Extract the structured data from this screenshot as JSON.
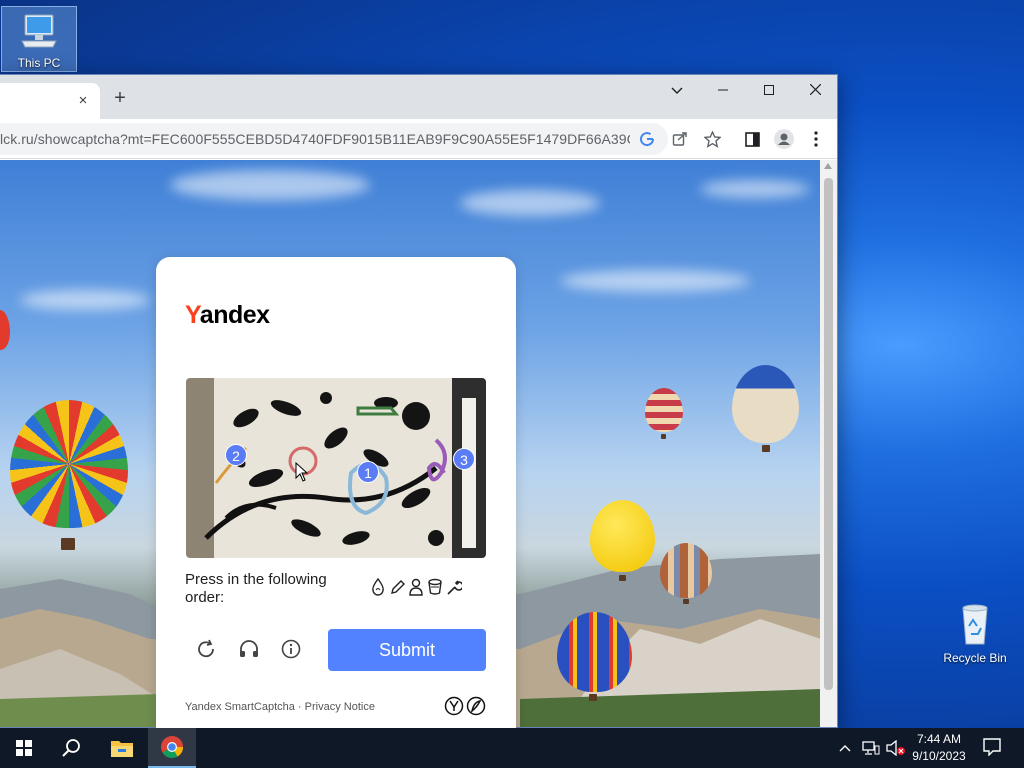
{
  "desktop": {
    "icons": [
      {
        "label": "This PC"
      },
      {
        "label": "Recycle Bin"
      }
    ]
  },
  "browser": {
    "tab": {
      "close_glyph": "×"
    },
    "new_tab_glyph": "+",
    "window_controls": {
      "tab_search": "⌄",
      "minimize": "—",
      "maximize": "☐",
      "close": "✕"
    },
    "address_bar": {
      "url": "lck.ru/showcaptcha?mt=FEC600F555CEBD5D4740FDF9015B11EAB9F9C90A55E5F1479DF66A39C93D..."
    },
    "toolbar_icons": [
      "google-lens-icon",
      "share-icon",
      "bookmark-star-icon",
      "side-panel-icon",
      "profile-icon",
      "menu-icon"
    ]
  },
  "captcha": {
    "brand_first_letter": "Y",
    "brand_rest": "andex",
    "markers": [
      "1",
      "2",
      "3"
    ],
    "instruction": "Press in the following order:",
    "order_icons": [
      "drop-icon",
      "pencil-icon",
      "person-icon",
      "bucket-icon",
      "wrench-icon"
    ],
    "controls": [
      "refresh-icon",
      "headphones-icon",
      "info-icon"
    ],
    "submit_label": "Submit",
    "footer_brand": "Yandex SmartCaptcha",
    "footer_sep": "·",
    "footer_link": "Privacy Notice",
    "colors": {
      "accent": "#5282ff",
      "brand_red": "#fc3f1d"
    }
  },
  "taskbar": {
    "time": "7:44 AM",
    "date": "9/10/2023",
    "pinned": [
      "start-icon",
      "search-icon",
      "file-explorer-icon",
      "chrome-icon"
    ]
  }
}
